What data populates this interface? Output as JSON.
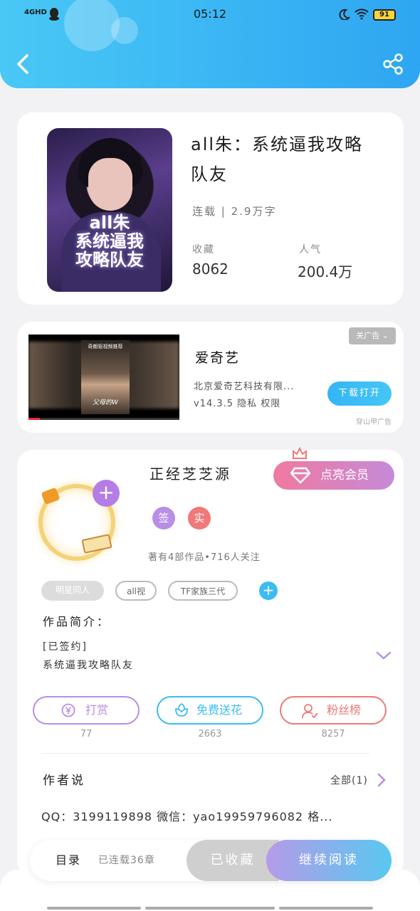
{
  "status_bar": {
    "network": "4GHD",
    "time": "05:12",
    "battery": "91"
  },
  "book": {
    "title": "all朱：系统逼我攻略队友",
    "cover_text": "all朱\n系统逼我\n攻略队友",
    "status": "连载",
    "word_count": "2.9万字",
    "meta": "连载 | 2.9万字",
    "stats": [
      {
        "label": "收藏",
        "value": "8062"
      },
      {
        "label": "人气",
        "value": "200.4万"
      }
    ]
  },
  "ad": {
    "close_label": "关广告",
    "video_title": "奇朗驱视频推荐",
    "video_caption": "父母的W",
    "app_name": "爱奇艺",
    "company": "北京爱奇艺科技有限...",
    "version": "v14.3.5  隐私  权限",
    "download_label": "下载打开",
    "source": "穿山甲广告"
  },
  "author": {
    "name": "正经芝芝源",
    "vip_label": "点亮会员",
    "badges": [
      {
        "text": "签",
        "color": "#b88ee6"
      },
      {
        "text": "实",
        "color": "#f07878"
      }
    ],
    "stats": "著有4部作品•716人关注",
    "tags": [
      "明星同人",
      "all视",
      "TF家族三代"
    ],
    "intro_heading": "作品简介：",
    "intro_lines": [
      "[已签约]",
      "系统逼我攻略队友"
    ],
    "actions": [
      {
        "label": "打赏",
        "count": "77",
        "color": "#b88ee6",
        "icon": "yen-coin-icon"
      },
      {
        "label": "免费送花",
        "count": "2663",
        "color": "#3bbcf3",
        "icon": "flower-icon"
      },
      {
        "label": "粉丝榜",
        "count": "8257",
        "color": "#f07878",
        "icon": "fans-icon"
      }
    ],
    "says_heading": "作者说",
    "says_all": "全部(1)",
    "says_text": "QQ：3199119898 微信：yao19959796082 格..."
  },
  "bottom_bar": {
    "toc_label": "目录",
    "chapters": "已连载36章",
    "favorited_label": "已收藏",
    "read_label": "继续阅读"
  },
  "colors": {
    "header_gradient": [
      "#49c8f5",
      "#2ea6f2"
    ],
    "purple": "#b88ee6",
    "blue": "#3bbcf3",
    "red": "#f07878"
  }
}
